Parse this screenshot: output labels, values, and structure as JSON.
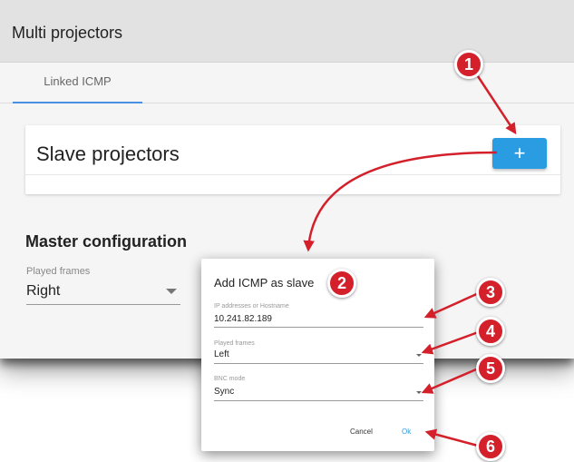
{
  "app": {
    "title": "Multi projectors"
  },
  "tabs": [
    {
      "label": "Linked ICMP",
      "active": true
    }
  ],
  "slave_card": {
    "title": "Slave projectors",
    "add_label": "+"
  },
  "master": {
    "title": "Master configuration",
    "played_frames_label": "Played frames",
    "played_frames_value": "Right"
  },
  "dialog": {
    "title": "Add ICMP as slave",
    "ip_label": "IP addresses or Hostname",
    "ip_value": "10.241.82.189",
    "frames_label": "Played frames",
    "frames_value": "Left",
    "bnc_label": "BNC mode",
    "bnc_value": "Sync",
    "cancel_label": "Cancel",
    "ok_label": "Ok"
  },
  "callouts": [
    "1",
    "2",
    "3",
    "4",
    "5",
    "6"
  ],
  "colors": {
    "accent": "#2a9de2",
    "callout": "#d3202a",
    "tab_indicator": "#4a90e2"
  }
}
